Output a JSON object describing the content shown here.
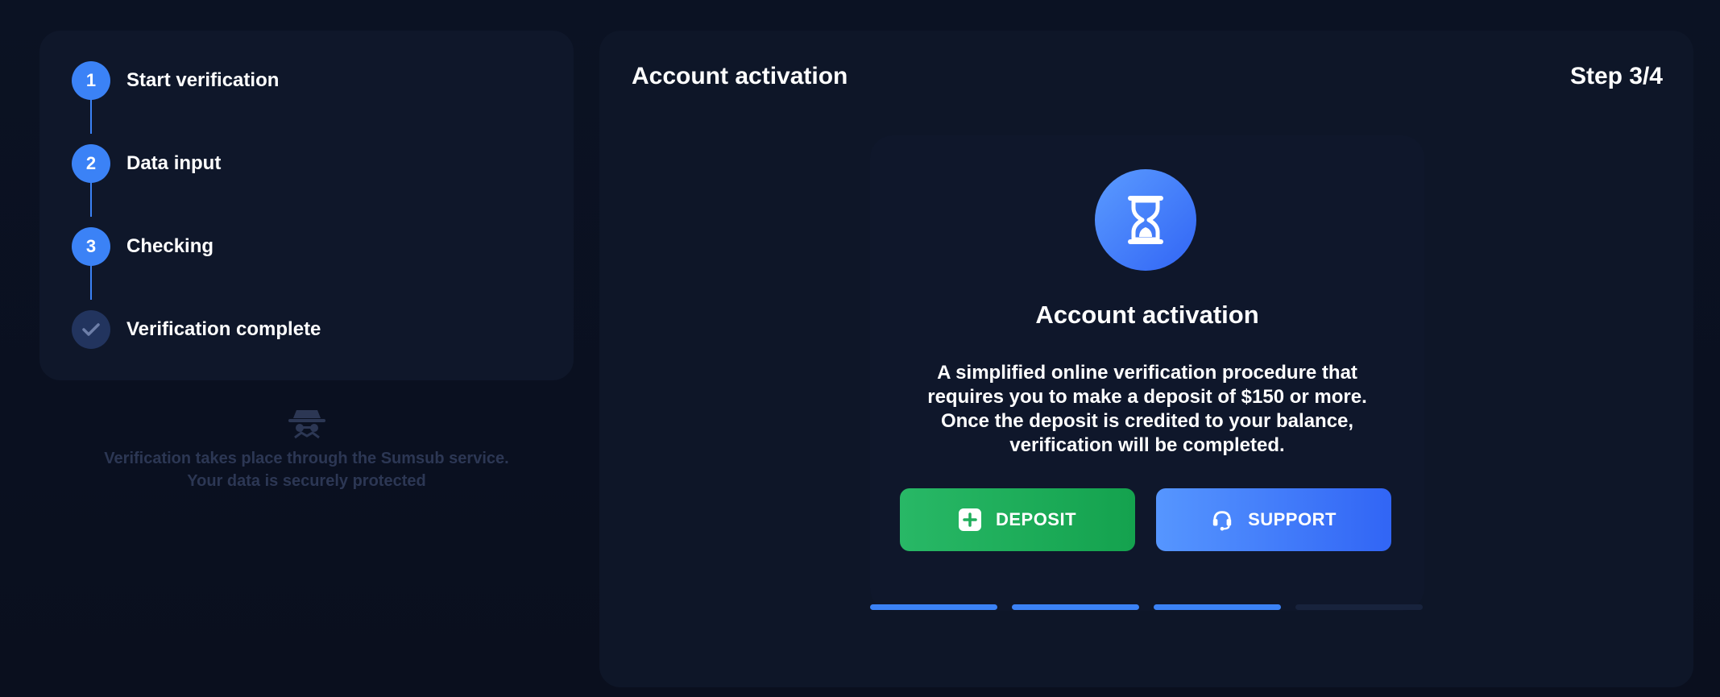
{
  "steps": [
    {
      "number": "1",
      "label": "Start verification",
      "status": "active"
    },
    {
      "number": "2",
      "label": "Data input",
      "status": "active"
    },
    {
      "number": "3",
      "label": "Checking",
      "status": "active"
    },
    {
      "number": "",
      "label": "Verification complete",
      "status": "pending",
      "icon": "check-icon"
    }
  ],
  "sumsub": {
    "icon": "spy-icon",
    "line1": "Verification takes place through the Sumsub service.",
    "line2": "Your data is securely protected"
  },
  "main": {
    "title": "Account activation",
    "step_indicator": "Step 3/4",
    "card": {
      "icon": "hourglass-icon",
      "title": "Account activation",
      "description": "A simplified online verification procedure that requires you to make a deposit of $150 or more. Once the deposit is credited to your balance, verification will be completed."
    },
    "buttons": {
      "deposit": {
        "label": "DEPOSIT",
        "icon": "plus-square-icon"
      },
      "support": {
        "label": "SUPPORT",
        "icon": "headset-icon"
      }
    },
    "progress": {
      "current": 3,
      "total": 4
    }
  },
  "colors": {
    "accent": "#3b82f6",
    "deposit": "#1fae5b",
    "background": "#0a1020"
  }
}
